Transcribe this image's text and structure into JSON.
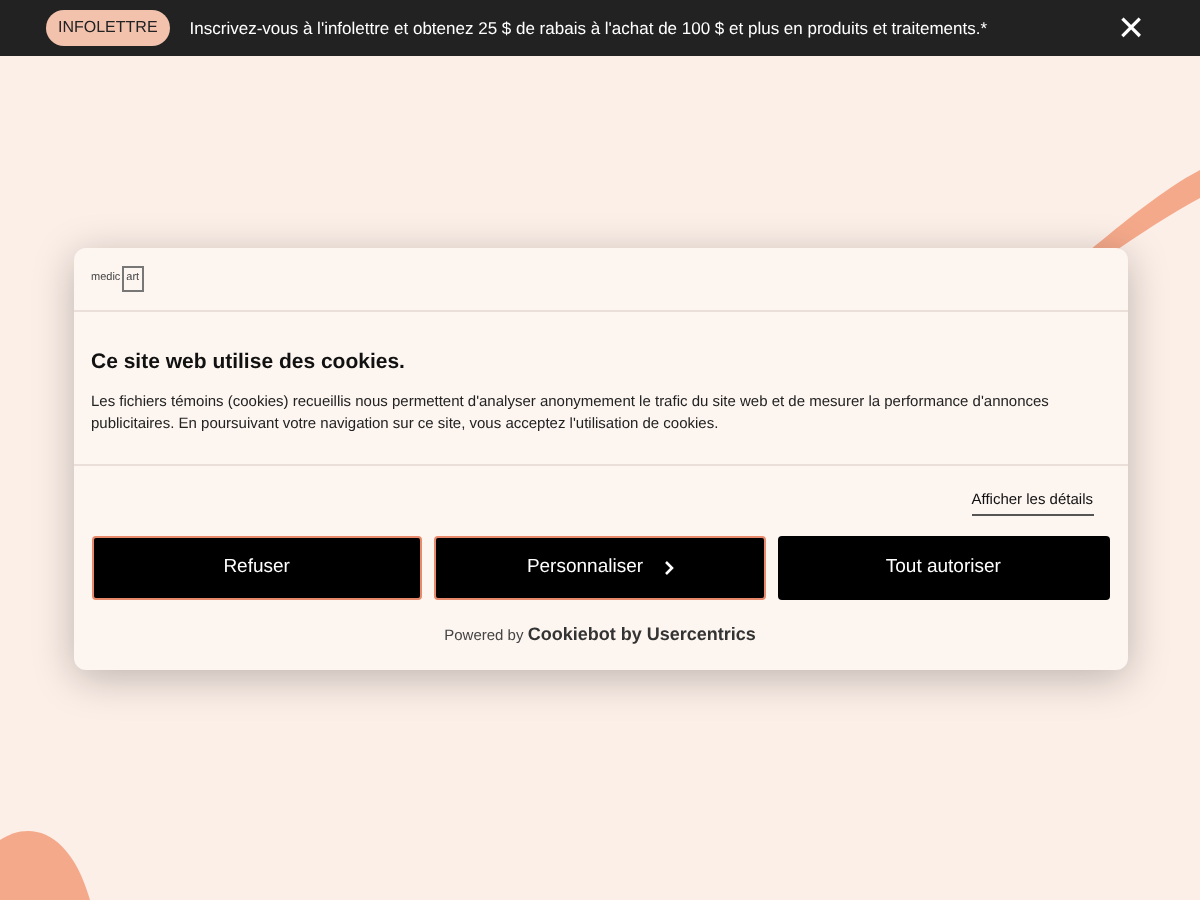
{
  "banner": {
    "badge": "INFOLETTRE",
    "message": "Inscrivez-vous à l'infolettre et obtenez 25 $ de rabais à l'achat de 100 $ et plus en produits et traitements.*",
    "close": "×"
  },
  "dialog": {
    "logo": [
      "medic",
      "art"
    ],
    "title": "Ce site web utilise des cookies.",
    "body": "Les fichiers témoins (cookies) recueillis nous permettent d'analyser anonymement le trafic du site web et de mesurer la performance d'annonces publicitaires. En poursuivant votre navigation sur ce site, vous acceptez l'utilisation de cookies.",
    "details_link": "Afficher les détails",
    "buttons": [
      {
        "label": "Refuser",
        "kind": "plain"
      },
      {
        "label": "Personnaliser",
        "kind": "chevron"
      },
      {
        "label": "Tout autoriser",
        "kind": "plain"
      }
    ],
    "powered_by": "Powered by **Cookiebot by Usercentrics**"
  }
}
